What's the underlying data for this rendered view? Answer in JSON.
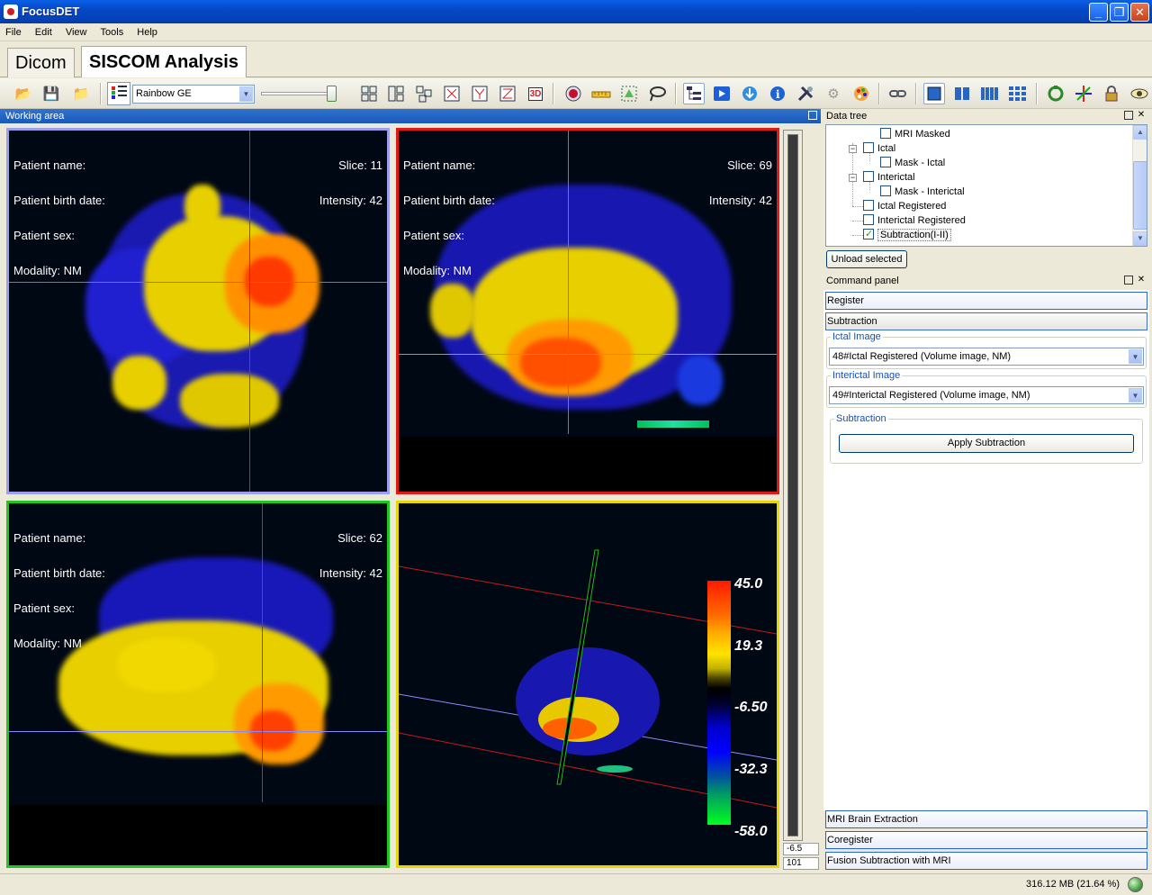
{
  "window": {
    "title": "FocusDET",
    "minimize": "_",
    "maximize": "❐",
    "close": "✕"
  },
  "menu": [
    "File",
    "Edit",
    "View",
    "Tools",
    "Help"
  ],
  "tabs": [
    {
      "label": "Dicom"
    },
    {
      "label": "SISCOM Analysis"
    }
  ],
  "toolbar": {
    "colormap": "Rainbow GE",
    "threed_label": "3D"
  },
  "working_area": {
    "title": "Working area"
  },
  "views": {
    "axial": {
      "patient_name": "Patient name:",
      "birth_date": "Patient birth date:",
      "sex": "Patient sex:",
      "modality": "Modality: NM",
      "slice": "Slice: 11",
      "intensity": "Intensity: 42"
    },
    "sagittal": {
      "patient_name": "Patient name:",
      "birth_date": "Patient birth date:",
      "sex": "Patient sex:",
      "modality": "Modality: NM",
      "slice": "Slice: 69",
      "intensity": "Intensity: 42"
    },
    "coronal": {
      "patient_name": "Patient name:",
      "birth_date": "Patient birth date:",
      "sex": "Patient sex:",
      "modality": "Modality: NM",
      "slice": "Slice: 62",
      "intensity": "Intensity: 42"
    },
    "volume": {
      "colorbar": [
        "45.0",
        "19.3",
        "-6.50",
        "-32.3",
        "-58.0"
      ]
    }
  },
  "slider_values": {
    "top": "-6.5",
    "bottom": "101"
  },
  "data_tree": {
    "title": "Data tree",
    "items": [
      {
        "label": "MRI Masked",
        "checked": false
      },
      {
        "label": "Ictal",
        "checked": false
      },
      {
        "label": "Mask - Ictal",
        "checked": false
      },
      {
        "label": "Interictal",
        "checked": false
      },
      {
        "label": "Mask - Interictal",
        "checked": false
      },
      {
        "label": "Ictal Registered",
        "checked": false
      },
      {
        "label": "Interictal Registered",
        "checked": false
      },
      {
        "label": "Subtraction(I-II)",
        "checked": true
      }
    ],
    "unload_button": "Unload selected"
  },
  "command_panel": {
    "title": "Command panel",
    "register": "Register",
    "subtraction": "Subtraction",
    "ictal_label": "Ictal Image",
    "ictal_value": "48#Ictal Registered (Volume image, NM)",
    "interictal_label": "Interictal Image",
    "interictal_value": "49#Interictal Registered (Volume image, NM)",
    "subtraction_group": "Subtraction",
    "apply_button": "Apply Subtraction",
    "bottom_items": [
      "MRI Brain Extraction",
      "Coregister",
      "Fusion Subtraction with MRI"
    ]
  },
  "status": {
    "memory": "316.12 MB (21.64 %)"
  }
}
